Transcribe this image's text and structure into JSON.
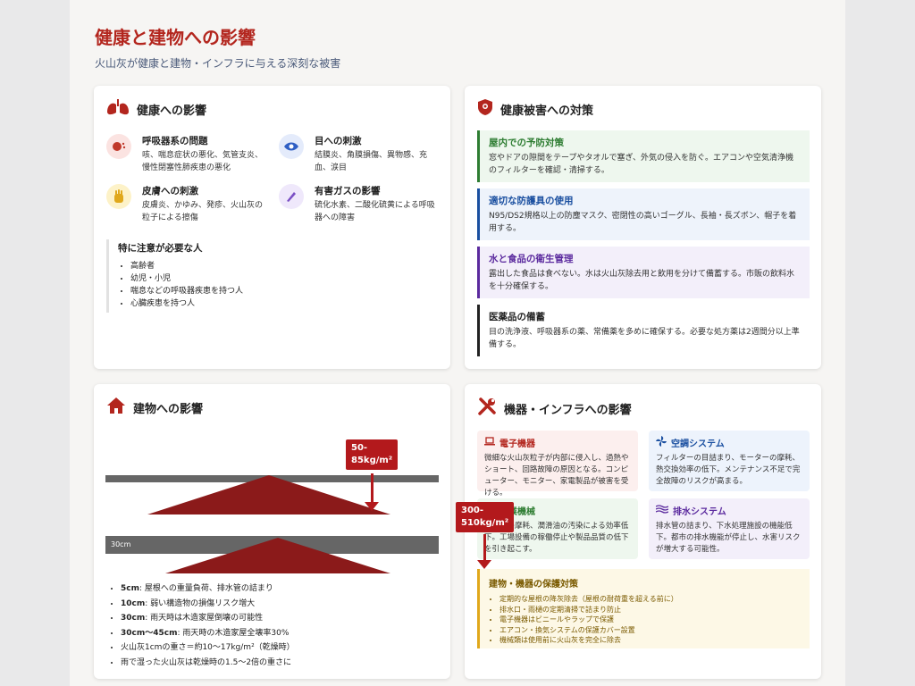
{
  "header": {
    "title": "健康と建物への影響",
    "subtitle": "火山灰が健康と建物・インフラに与える深刻な被害"
  },
  "health": {
    "heading": "健康への影響",
    "items": [
      {
        "title": "呼吸器系の問題",
        "desc": "咳、喘息症状の悪化、気管支炎、慢性閉塞性肺疾患の悪化"
      },
      {
        "title": "目への刺激",
        "desc": "結膜炎、角膜損傷、異物感、充血、涙目"
      },
      {
        "title": "皮膚への刺激",
        "desc": "皮膚炎、かゆみ、発疹、火山灰の粒子による擦傷"
      },
      {
        "title": "有害ガスの影響",
        "desc": "硫化水素、二酸化硫黄による呼吸器への障害"
      }
    ],
    "special_title": "特に注意が必要な人",
    "special_list": [
      "高齢者",
      "幼児・小児",
      "喘息などの呼吸器疾患を持つ人",
      "心臓疾患を持つ人"
    ]
  },
  "measures": {
    "heading": "健康被害への対策",
    "items": [
      {
        "title": "屋内での予防対策",
        "desc": "窓やドアの隙間をテープやタオルで塞ぎ、外気の侵入を防ぐ。エアコンや空気清浄機のフィルターを確認・清掃する。",
        "color": "#2e7d32",
        "bg": "#eef7ee"
      },
      {
        "title": "適切な防護具の使用",
        "desc": "N95/DS2規格以上の防塵マスク、密閉性の高いゴーグル、長袖・長ズボン、帽子を着用する。",
        "color": "#1a4fa0",
        "bg": "#eef3fb"
      },
      {
        "title": "水と食品の衛生管理",
        "desc": "露出した食品は食べない。水は火山灰除去用と飲用を分けて備蓄する。市販の飲料水を十分確保する。",
        "color": "#5b2a9e",
        "bg": "#f3effa"
      },
      {
        "title": "医薬品の備蓄",
        "desc": "目の洗浄液、呼吸器系の薬、常備薬を多めに確保する。必要な処方薬は2週間分以上準備する。",
        "color": "#222222",
        "bg": "#ffffff"
      }
    ]
  },
  "buildings": {
    "heading": "建物への影響",
    "callout_1": "50-\n85kg/m²",
    "callout_2": "300-\n510kg/m²",
    "bar_label": "30cm",
    "list": [
      {
        "bold": "5cm",
        "text": ": 屋根への重量負荷、排水管の詰まり"
      },
      {
        "bold": "10cm",
        "text": ": 弱い構造物の損傷リスク増大"
      },
      {
        "bold": "30cm",
        "text": ": 雨天時は木造家屋倒壊の可能性"
      },
      {
        "bold": "30cm〜45cm",
        "text": ": 雨天時の木造家屋全壊率30%"
      },
      {
        "bold": "",
        "text": "火山灰1cmの重さ＝約10〜17kg/m²（乾燥時）"
      },
      {
        "bold": "",
        "text": "雨で湿った火山灰は乾燥時の1.5〜2倍の重さに"
      }
    ]
  },
  "infra": {
    "heading": "機器・インフラへの影響",
    "boxes": [
      {
        "title": "電子機器",
        "desc": "微細な火山灰粒子が内部に侵入し、過熱やショート、回路故障の原因となる。コンピューター、モニター、家電製品が被害を受ける。",
        "color": "#b3261e",
        "bg": "#fcefee",
        "icon": "laptop-icon"
      },
      {
        "title": "空調システム",
        "desc": "フィルターの目詰まり、モーターの摩耗、熱交換効率の低下。メンテナンス不足で完全故障のリスクが高まる。",
        "color": "#1a4fa0",
        "bg": "#edf3fc",
        "icon": "fan-icon"
      },
      {
        "title": "産業機械",
        "desc": "可動部の摩耗、潤滑油の汚染による効率低下。工場設備の稼働停止や製品品質の低下を引き起こす。",
        "color": "#2e7d32",
        "bg": "#eef7ee",
        "icon": "gear-icon"
      },
      {
        "title": "排水システム",
        "desc": "排水管の詰まり、下水処理施設の機能低下。都市の排水機能が停止し、水害リスクが増大する可能性。",
        "color": "#5b2a9e",
        "bg": "#f3effa",
        "icon": "water-icon"
      }
    ],
    "protect_title": "建物・機器の保護対策",
    "protect_list": [
      "定期的な屋根の降灰除去（屋根の耐荷重を超える前に）",
      "排水口・雨樋の定期清掃で詰まり防止",
      "電子機器はビニールやラップで保護",
      "エアコン・換気システムの保護カバー設置",
      "機械類は使用前に火山灰を完全に除去"
    ]
  },
  "colors": {
    "accent": "#b3261e",
    "red_arrow": "#b3191c",
    "roof": "#8b1a1a"
  }
}
